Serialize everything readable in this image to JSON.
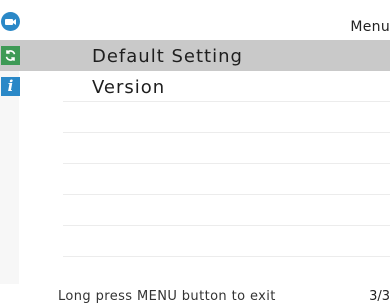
{
  "header": {
    "title": "Menu",
    "icon": "camera-icon",
    "icon_color": "#2a88c7"
  },
  "menu": {
    "items": [
      {
        "label": "Default Setting",
        "icon": "refresh-icon",
        "icon_color": "#3e9a56",
        "selected": true
      },
      {
        "label": "Version",
        "icon": "info-icon",
        "icon_glyph": "i",
        "icon_color": "#2a88c7",
        "selected": false
      }
    ]
  },
  "footer": {
    "hint": "Long press MENU button to exit",
    "page": "3/3"
  },
  "colors": {
    "selected_row": "#c9c9c9",
    "background": "#ffffff",
    "sidebar": "#f7f7f7"
  }
}
